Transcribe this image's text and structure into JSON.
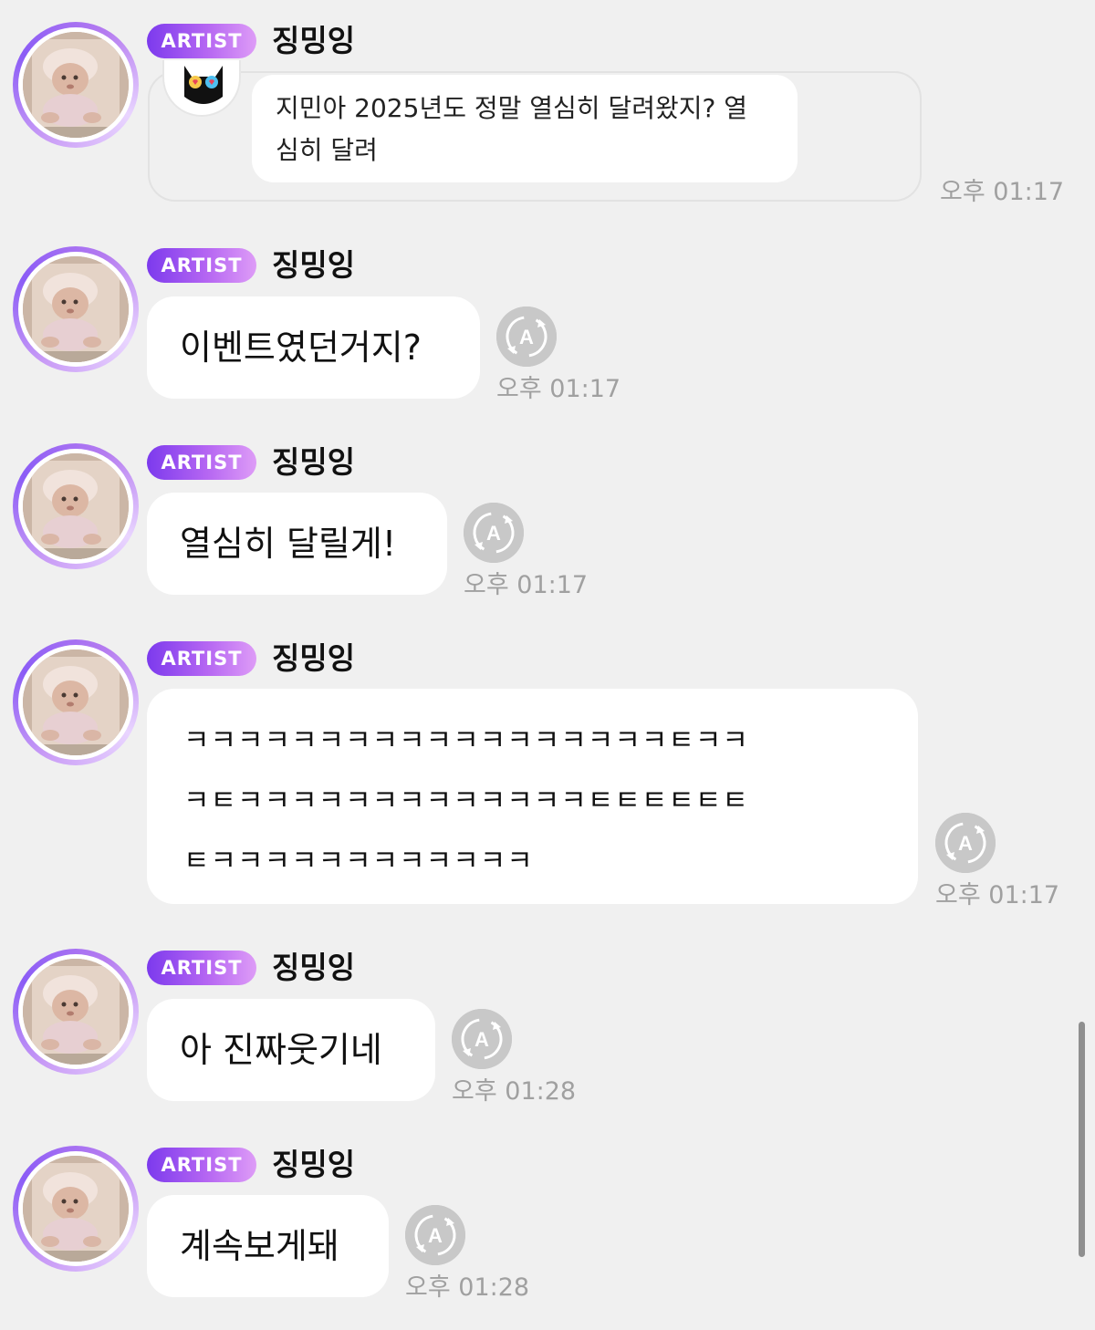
{
  "badge_label": "ARTIST",
  "colors": {
    "background": "#f0f0f0",
    "badge_gradient_start": "#7c3aed",
    "badge_gradient_end": "#de9cf7",
    "avatar_ring": "#8b5cf6",
    "bubble": "#ffffff",
    "timestamp": "#a0a0a0",
    "translate_icon": "#c8c8c8"
  },
  "icons": {
    "avatar": "baby-photo-avatar",
    "quote_avatar": "black-cat-heart-eyes-icon",
    "translate": "translate-a-icon"
  },
  "messages": [
    {
      "sender": "징밍잉",
      "type": "reply",
      "quoted_text": "지민아 2025년도 정말 열심히 달려왔지? 열심히 달려",
      "quoted_lines": [
        "지민아 2025년도 정말 열심히 달려왔지? 열",
        "심히 달려"
      ],
      "time": "오후 01:17"
    },
    {
      "sender": "징밍잉",
      "type": "text",
      "text": "이벤트였던거지?",
      "time": "오후 01:17"
    },
    {
      "sender": "징밍잉",
      "type": "text",
      "text": "열심히 달릴게!",
      "time": "오후 01:17"
    },
    {
      "sender": "징밍잉",
      "type": "text",
      "lines": [
        "ㅋㅋㅋㅋㅋㅋㅋㅋㅋㅋㅋㅋㅋㅋㅋㅋㅋㅋㅌㅋㅋ",
        "ㅋㅌㅋㅋㅋㅋㅋㅋㅋㅋㅋㅋㅋㅋㅋㅌㅌㅌㅌㅌㅌ",
        "ㅌㅋㅋㅋㅋㅋㅋㅋㅋㅋㅋㅋㅋ"
      ],
      "time": "오후 01:17"
    },
    {
      "sender": "징밍잉",
      "type": "text",
      "text": "아 진짜웃기네",
      "time": "오후 01:28"
    },
    {
      "sender": "징밍잉",
      "type": "text",
      "text": "계속보게돼",
      "time": "오후 01:28"
    }
  ]
}
